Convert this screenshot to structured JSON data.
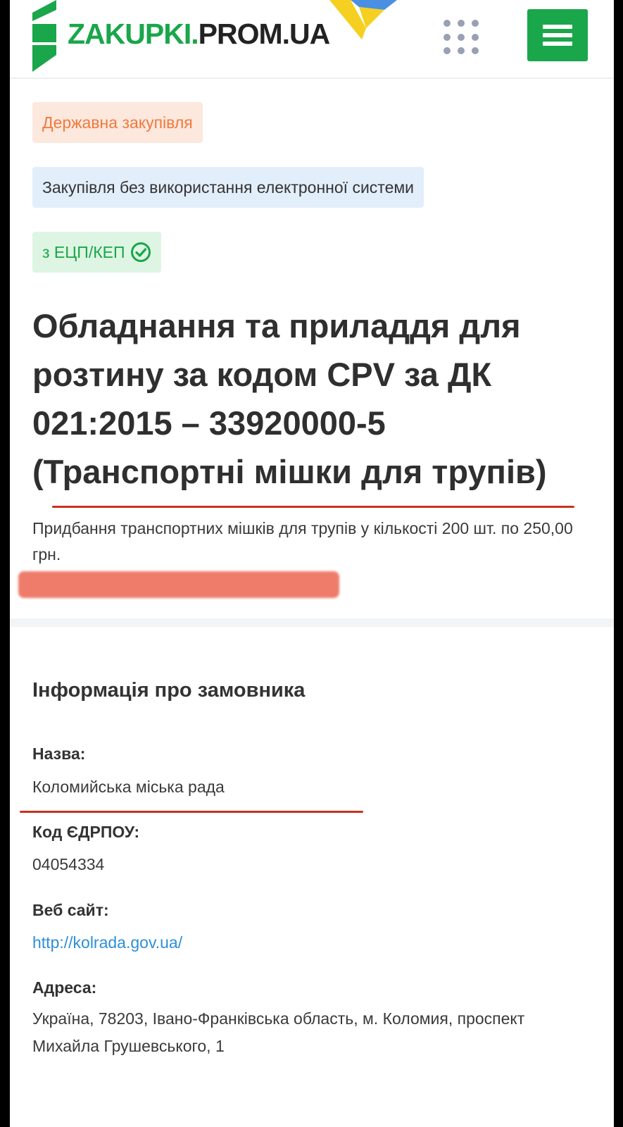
{
  "header": {
    "logo_text_green": "ZAKUPKI.",
    "logo_text_dark": "PROM.UA",
    "apps_icon": "grid-dots-icon",
    "menu_icon": "hamburger-icon",
    "colors": {
      "brand_green": "#1aa64b",
      "flag_blue": "#4a90e2",
      "flag_yellow": "#f5d020"
    }
  },
  "badges": {
    "state": "Державна закупівля",
    "type": "Закупівля без використання електронної системи",
    "signature": "з ЕЦП/КЕП",
    "signature_icon": "check-circle-icon"
  },
  "tender": {
    "title": "Обладнання та приладдя для розтину за кодом CPV за ДК 021:2015 – 33920000-5 (Транспортні мішки для трупів)",
    "description": "Придбання транспортних мішків для трупів у кількості 200 шт. по 250,00 грн."
  },
  "customer": {
    "section_title": "Інформація про замовника",
    "name_label": "Назва:",
    "name_value": "Коломийська міська рада",
    "code_label": "Код ЄДРПОУ:",
    "code_value": "04054334",
    "website_label": "Веб сайт:",
    "website_value": "http://kolrada.gov.ua/",
    "address_label": "Адреса:",
    "address_value": "Україна, 78203, Івано-Франківська область, м. Коломия, проспект Михайла Грушевського, 1"
  },
  "annotations": {
    "underline_color": "#c9321f",
    "redaction_color": "#ef7c6b"
  }
}
